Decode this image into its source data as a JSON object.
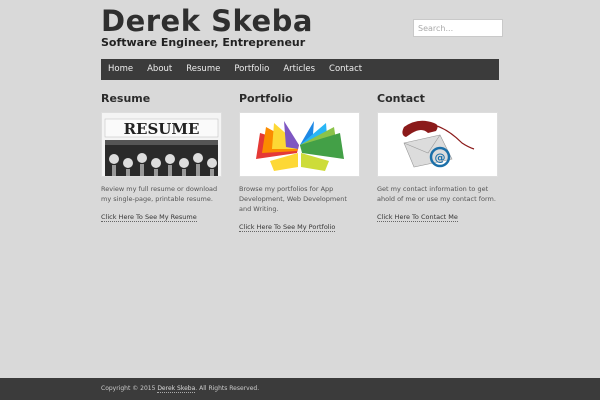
{
  "header": {
    "title": "Derek Skeba",
    "tagline": "Software Engineer, Entrepreneur",
    "search_placeholder": "Search..."
  },
  "nav": {
    "items": [
      "Home",
      "About",
      "Resume",
      "Portfolio",
      "Articles",
      "Contact"
    ]
  },
  "columns": [
    {
      "heading": "Resume",
      "image_text": "RESUME",
      "description": "Review my full resume or download my single-page, printable resume.",
      "link": "Click Here To See My Resume"
    },
    {
      "heading": "Portfolio",
      "description": "Browse my portfolios for App Development, Web Development and Writing.",
      "link": "Click Here To See My Portfolio"
    },
    {
      "heading": "Contact",
      "description": "Get my contact information to get ahold of me or use my contact form.",
      "link": "Click Here To Contact Me"
    }
  ],
  "footer": {
    "prefix": "Copyright © 2015 ",
    "name_link": "Derek Skeba",
    "suffix": ". All Rights Reserved."
  },
  "colors": {
    "background": "#d9d9d9",
    "nav_bar": "#3b3b3b",
    "footer_bar": "#3b3b3b"
  }
}
